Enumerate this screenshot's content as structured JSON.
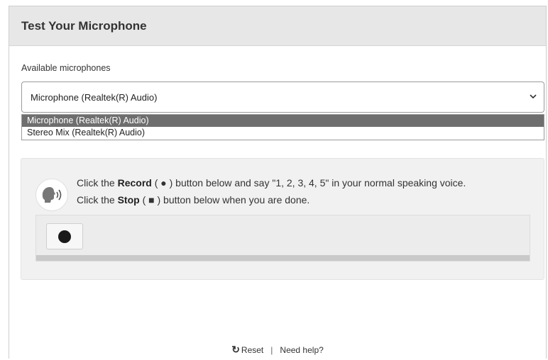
{
  "header": {
    "title": "Test Your Microphone"
  },
  "microphones": {
    "label": "Available microphones",
    "selected": "Microphone (Realtek(R) Audio)",
    "options": [
      "Microphone (Realtek(R) Audio)",
      "Stereo Mix (Realtek(R) Audio)"
    ]
  },
  "instructions": {
    "line1_pre": "Click the ",
    "line1_bold": "Record",
    "line1_mid": " ( ● ) button below and say \"1, 2, 3, 4, 5\" in your normal speaking voice.",
    "line2_pre": "Click the ",
    "line2_bold": "Stop",
    "line2_mid": " ( ■ ) button below when you are done."
  },
  "footer": {
    "reset": "Reset",
    "separator": "|",
    "help": "Need help?"
  },
  "icons": {
    "speaker": "speaker-voice-icon",
    "record": "record-icon",
    "reset": "reset-icon",
    "dropdown": "chevron-down-icon"
  }
}
